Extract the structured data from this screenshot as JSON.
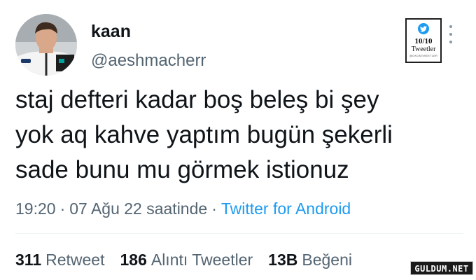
{
  "user": {
    "display_name": "kaan",
    "handle": "@aeshmacherr"
  },
  "badge": {
    "score": "10/10",
    "label": "Tweetler",
    "small_text": "@OKONTWEETLER"
  },
  "tweet": {
    "lines": [
      "staj defteri kadar boş beleş bi şey",
      "yok aq kahve yaptım bugün şekerli",
      "sade bunu mu görmek istionuz"
    ]
  },
  "meta": {
    "time": "19:20",
    "date": "07 Ağu 22 saatinde",
    "separator": "·",
    "source": "Twitter for Android"
  },
  "stats": {
    "retweets_count": "311",
    "retweets_label": "Retweet",
    "quotes_count": "186",
    "quotes_label": "Alıntı Tweetler",
    "likes_count": "13B",
    "likes_label": "Beğeni"
  },
  "watermark": "GULDUM.NET",
  "colors": {
    "accent": "#1d9bf0",
    "secondary_text": "#536471",
    "primary_text": "#0f1419"
  }
}
